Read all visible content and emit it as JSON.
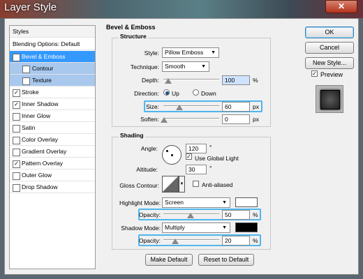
{
  "window": {
    "title": "Layer Style",
    "close_glyph": "✕"
  },
  "styles_list": {
    "header": "Styles",
    "blending": "Blending Options: Default",
    "items": [
      {
        "label": "Bevel & Emboss",
        "checked": true,
        "selected": true
      },
      {
        "label": "Contour",
        "checked": false,
        "sub": true
      },
      {
        "label": "Texture",
        "checked": false,
        "sub": true
      },
      {
        "label": "Stroke",
        "checked": true
      },
      {
        "label": "Inner Shadow",
        "checked": true
      },
      {
        "label": "Inner Glow",
        "checked": false
      },
      {
        "label": "Satin",
        "checked": false
      },
      {
        "label": "Color Overlay",
        "checked": false
      },
      {
        "label": "Gradient Overlay",
        "checked": false
      },
      {
        "label": "Pattern Overlay",
        "checked": true
      },
      {
        "label": "Outer Glow",
        "checked": false
      },
      {
        "label": "Drop Shadow",
        "checked": false
      }
    ],
    "check_glyph": "✓"
  },
  "bevel": {
    "section_title": "Bevel & Emboss",
    "structure_title": "Structure",
    "style_label": "Style:",
    "style_value": "Pillow Emboss",
    "technique_label": "Technique:",
    "technique_value": "Smooth",
    "depth_label": "Depth:",
    "depth_value": "100",
    "depth_unit": "%",
    "direction_label": "Direction:",
    "direction_up": "Up",
    "direction_down": "Down",
    "size_label": "Size:",
    "size_value": "60",
    "size_unit": "px",
    "soften_label": "Soften:",
    "soften_value": "0",
    "soften_unit": "px"
  },
  "shading": {
    "title": "Shading",
    "angle_label": "Angle:",
    "angle_value": "120",
    "degree": "°",
    "global_light": "Use Global Light",
    "altitude_label": "Altitude:",
    "altitude_value": "30",
    "gloss_label": "Gloss Contour:",
    "anti_aliased": "Anti-aliased",
    "highlight_label": "Highlight Mode:",
    "highlight_value": "Screen",
    "highlight_opacity_label": "Opacity:",
    "highlight_opacity": "50",
    "pct": "%",
    "shadow_label": "Shadow Mode:",
    "shadow_value": "Multiply",
    "shadow_opacity_label": "Opacity:",
    "shadow_opacity": "20",
    "highlight_color": "#ffffff",
    "shadow_color": "#000000",
    "arrow_glyph": "▼"
  },
  "buttons": {
    "ok": "OK",
    "cancel": "Cancel",
    "new_style": "New Style...",
    "preview": "Preview",
    "make_default": "Make Default",
    "reset_default": "Reset to Default"
  }
}
